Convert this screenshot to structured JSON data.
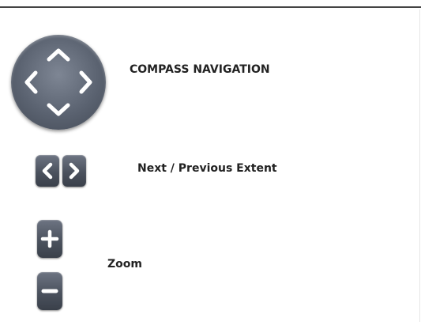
{
  "labels": {
    "compass": "COMPASS NAVIGATION",
    "extent": "Next / Previous Extent",
    "zoom": "Zoom"
  },
  "icons": {
    "compass": "compass-navigation-icon",
    "up": "chevron-up-icon",
    "down": "chevron-down-icon",
    "left": "chevron-left-icon",
    "right": "chevron-right-icon",
    "zoom_in": "plus-icon",
    "zoom_out": "minus-icon"
  },
  "colors": {
    "control_body": "#4b525e",
    "glyph": "#ffffff",
    "text": "#222222",
    "top_rule": "#444444"
  }
}
